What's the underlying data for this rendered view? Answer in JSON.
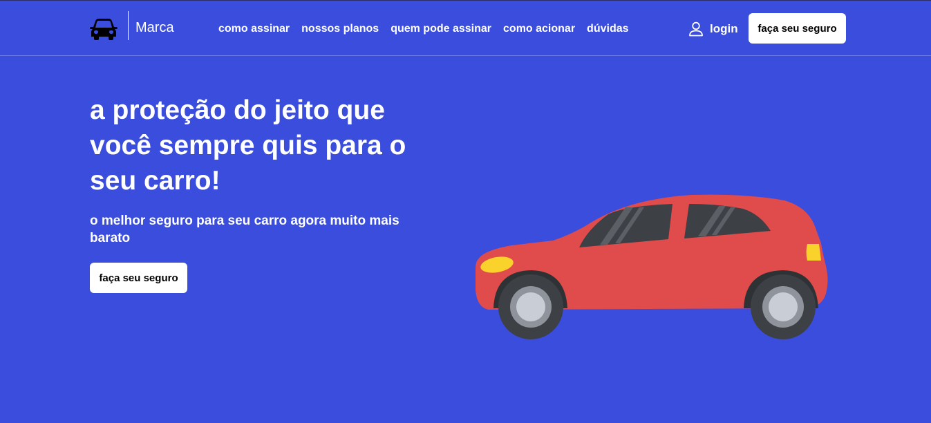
{
  "header": {
    "logo_icon": "car-icon",
    "brand": "Marca",
    "nav": [
      {
        "label": "como assinar"
      },
      {
        "label": "nossos planos"
      },
      {
        "label": "quem pode assinar"
      },
      {
        "label": "como acionar"
      },
      {
        "label": "dúvidas"
      }
    ],
    "login_icon": "user-icon",
    "login_label": "login",
    "cta_label": "faça seu seguro"
  },
  "hero": {
    "title": "a proteção do jeito que você sempre quis para o seu carro!",
    "subtitle": "o melhor seguro para seu carro agora muito mais barato",
    "cta_label": "faça seu seguro",
    "illustration": "red-car-illustration"
  },
  "colors": {
    "background": "#3a4ddc",
    "car_body": "#e04b4b",
    "button_bg": "#ffffff",
    "text": "#ffffff"
  }
}
